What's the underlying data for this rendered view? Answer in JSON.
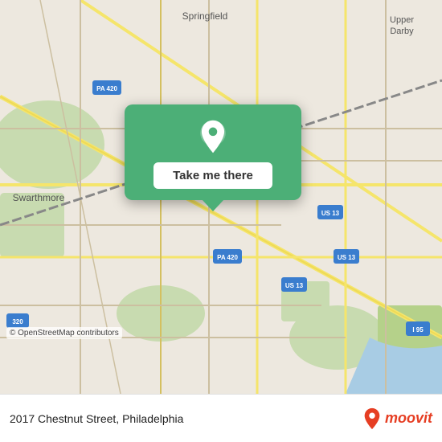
{
  "map": {
    "background_color": "#e8e0d8",
    "credit": "© OpenStreetMap contributors"
  },
  "popup": {
    "button_label": "Take me there",
    "pin_color": "#ffffff"
  },
  "bottom_bar": {
    "address": "2017 Chestnut Street, Philadelphia",
    "logo_text": "moovit"
  },
  "labels": {
    "springfield": "Springfield",
    "upper_darby": "Upper\nDarby",
    "swarthmore": "Swarthmore",
    "pa420_top": "PA 420",
    "pa420_mid": "PA 420",
    "pa420_bot": "PA 420",
    "us13_mid": "US 13",
    "us13_bot": "US 13",
    "us13_right": "US 13",
    "i95": "I 95",
    "rt320": "320"
  }
}
